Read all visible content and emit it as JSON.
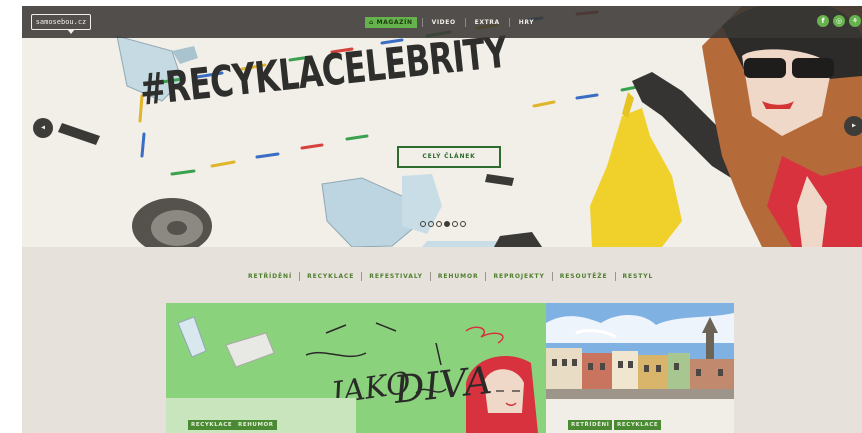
{
  "header": {
    "logo": "samosebou.cz",
    "nav": [
      {
        "label": "MAGAZÍN",
        "active": true,
        "icon": "home-icon"
      },
      {
        "label": "VIDEO",
        "active": false
      },
      {
        "label": "EXTRA",
        "active": false
      },
      {
        "label": "HRY",
        "active": false
      }
    ],
    "social": [
      {
        "icon": "facebook-icon",
        "glyph": "f"
      },
      {
        "icon": "instagram-icon",
        "glyph": "◎"
      },
      {
        "icon": "share-icon",
        "glyph": "⚘"
      }
    ]
  },
  "hero": {
    "title": "#RECYKLACELEBRITY",
    "cta_label": "CELÝ ČLÁNEK",
    "slide_count": 6,
    "active_slide": 4,
    "prev_icon": "arrow-left-icon",
    "next_icon": "arrow-right-icon"
  },
  "categories": [
    "RETŘÍDĚNÍ",
    "RECYKLACE",
    "REFESTIVALY",
    "REHUMOR",
    "REPROJEKTY",
    "RESOUTĚŽE",
    "RESTYL"
  ],
  "cards": [
    {
      "tags": [
        "RECYKLACE",
        "REHUMOR"
      ],
      "art_text_1": "JAKO",
      "art_text_2": "DIVA"
    },
    {
      "tags": [
        "RETŘÍDĚNÍ",
        "RECYKLACE"
      ]
    }
  ],
  "colors": {
    "accent_green": "#66b24c",
    "dark": "#3d3c39",
    "card_green": "#8bd27d"
  }
}
